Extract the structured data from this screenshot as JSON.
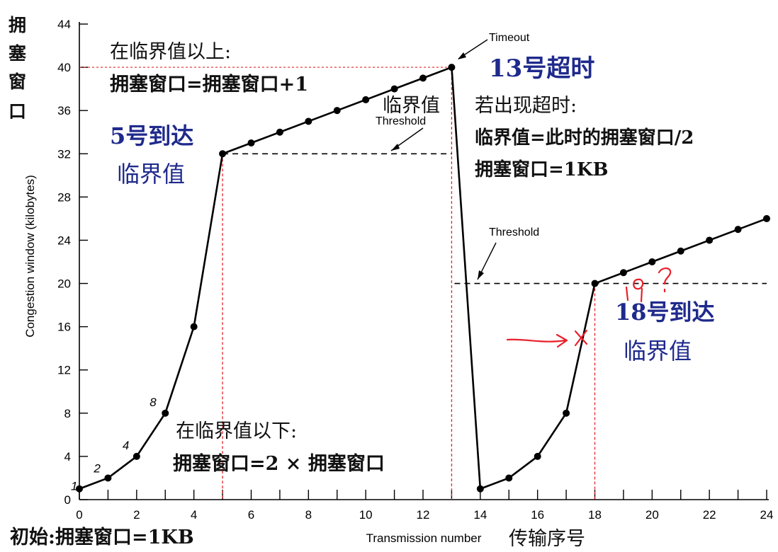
{
  "chart_data": {
    "type": "line",
    "xlabel": "Transmission number",
    "ylabel": "Congestion window (kilobytes)",
    "xlim": [
      0,
      24
    ],
    "ylim": [
      0,
      44
    ],
    "xticks": [
      0,
      2,
      4,
      6,
      8,
      10,
      12,
      14,
      16,
      18,
      20,
      22,
      24
    ],
    "yticks": [
      0,
      4,
      8,
      12,
      16,
      20,
      24,
      28,
      32,
      36,
      40,
      44
    ],
    "grid": false,
    "series": [
      {
        "name": "",
        "color": "#000000",
        "x": [
          0,
          1,
          2,
          3,
          4,
          5,
          6,
          7,
          8,
          9,
          10,
          11,
          12,
          13,
          14,
          15,
          16,
          17,
          18,
          19,
          20,
          21,
          22,
          23,
          24
        ],
        "y": [
          1,
          2,
          4,
          8,
          16,
          32,
          33,
          34,
          35,
          36,
          37,
          38,
          39,
          40,
          1,
          2,
          4,
          8,
          20,
          21,
          22,
          23,
          24,
          25,
          26
        ]
      }
    ],
    "thresholds": [
      {
        "label": "Threshold",
        "y": 32,
        "x_start": 5,
        "x_end": 13
      },
      {
        "label": "Threshold",
        "y": 20,
        "x_start": 13.1,
        "x_end": 24
      }
    ],
    "timeout_label": "Timeout",
    "red_guides": [
      {
        "x": 5,
        "y": 32
      },
      {
        "x": 13,
        "y": 40
      },
      {
        "x": 18,
        "y": 20
      }
    ],
    "handwritten_point_labels": [
      {
        "x": 0,
        "text": "1"
      },
      {
        "x": 1,
        "text": "2"
      },
      {
        "x": 2,
        "text": "4"
      },
      {
        "x": 3,
        "text": "8"
      }
    ]
  },
  "labels": {
    "ylabel_cn": [
      "拥",
      "塞",
      "窗",
      "口"
    ],
    "xlabel_cn": "传输序号",
    "initial": "初始:拥塞窗口=1KB",
    "above_title": "在临界值以上:",
    "above_rule": "拥塞窗口=拥塞窗口+1",
    "below_title": "在临界值以下:",
    "below_rule": "拥塞窗口=2 × 拥塞窗口",
    "timeout_title": "若出现超时:",
    "timeout_rule1": "临界值=此时的拥塞窗口/2",
    "timeout_rule2": "拥塞窗口=1KB",
    "threshold_cn": "临界值",
    "reach5_a": "5号到达",
    "reach5_b": "临界值",
    "timeout13": "13号超时",
    "reach18_a": "18号到达",
    "reach18_b": "临界值"
  }
}
